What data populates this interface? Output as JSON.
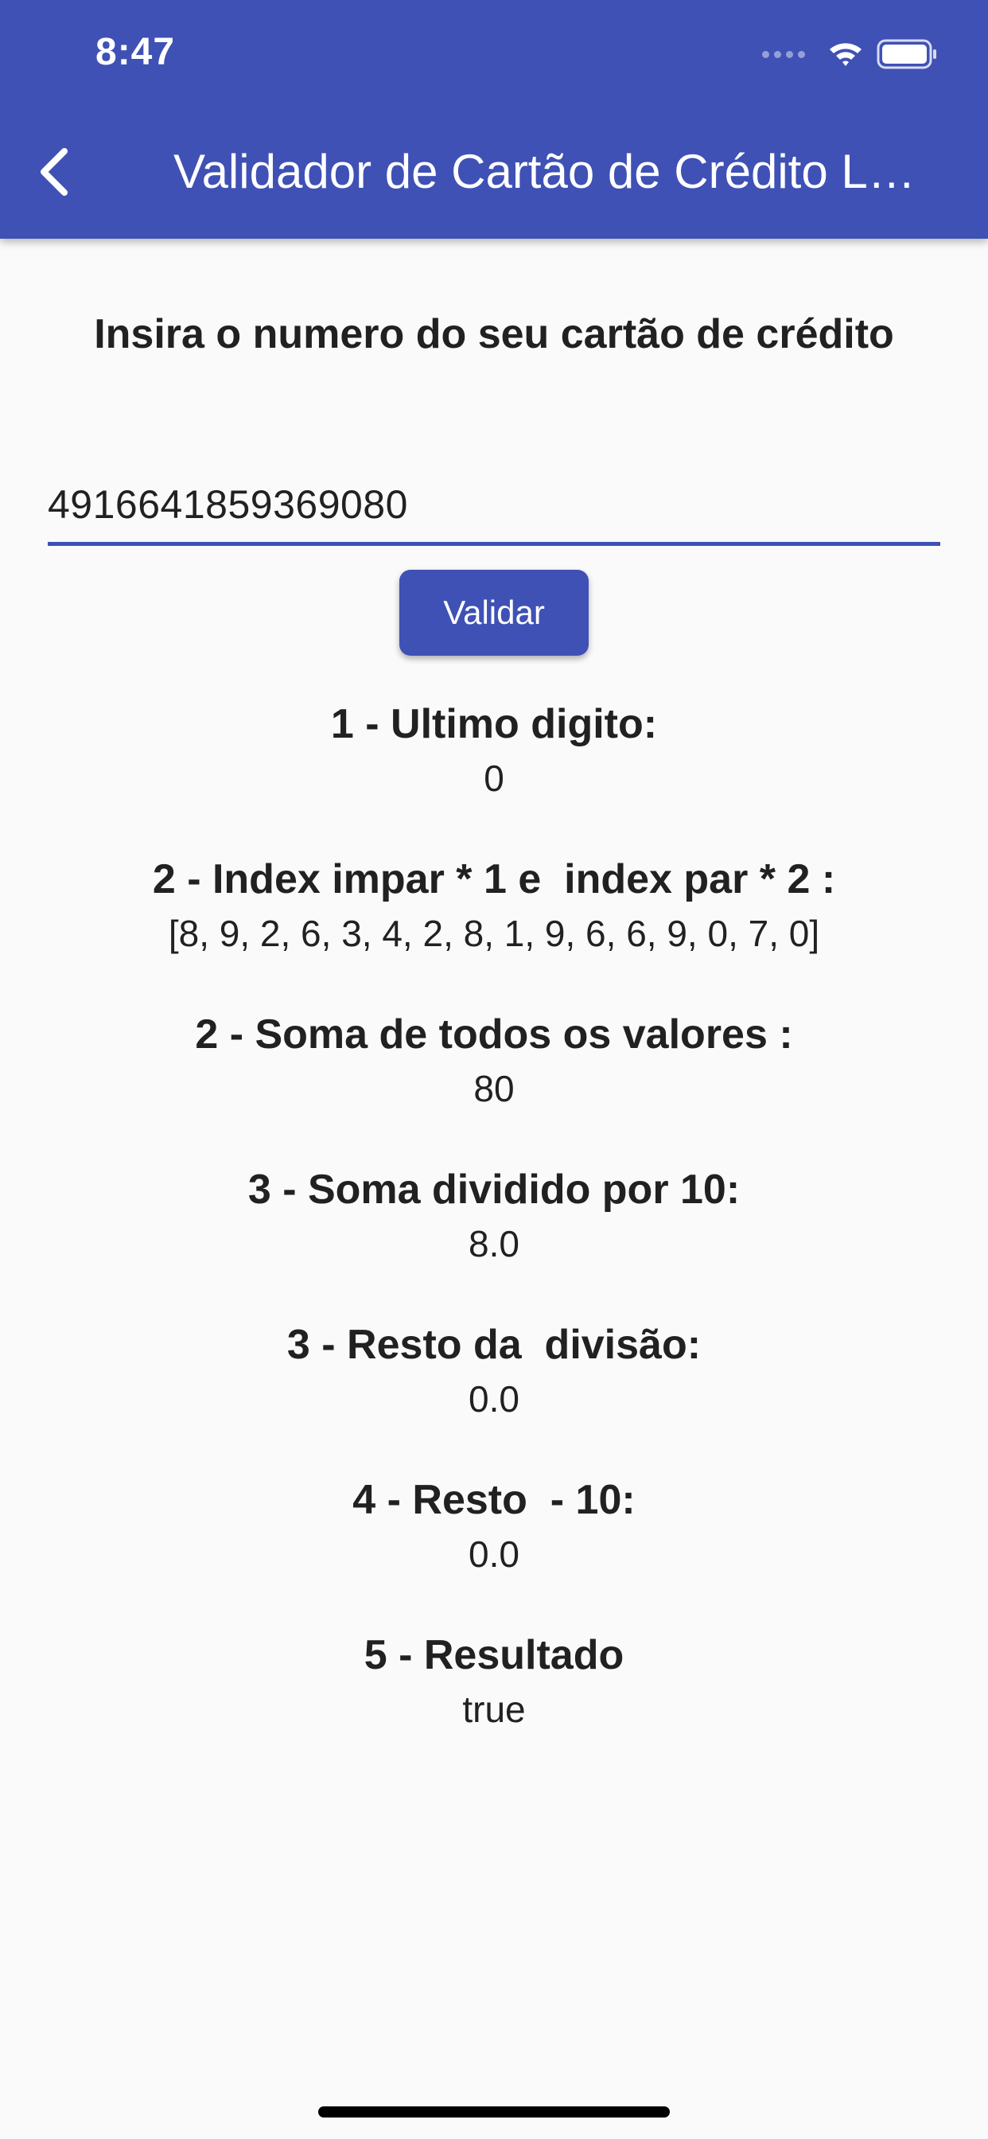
{
  "colors": {
    "primary": "#3f51b5",
    "background": "#fafafa",
    "text": "#212121",
    "on_primary": "#ffffff"
  },
  "status_bar": {
    "time": "8:47",
    "icons": [
      "signal-icon",
      "wifi-icon",
      "battery-icon"
    ]
  },
  "app_bar": {
    "back_icon": "chevron-left-icon",
    "title": "Validador de Cartão de Crédito Luhn"
  },
  "form": {
    "prompt": "Insira o numero do seu cartão de crédito",
    "card_number": "4916641859369080",
    "validate_label": "Validar"
  },
  "results": [
    {
      "label": "1 - Ultimo digito:",
      "value": "0"
    },
    {
      "label": "2 - Index impar * 1 e  index par * 2 :",
      "value": "[8, 9, 2, 6, 3, 4, 2, 8, 1, 9, 6, 6, 9, 0, 7, 0]"
    },
    {
      "label": "2 - Soma de todos os valores :",
      "value": "80"
    },
    {
      "label": "3 - Soma dividido por 10:",
      "value": "8.0"
    },
    {
      "label": "3 - Resto da  divisão:",
      "value": "0.0"
    },
    {
      "label": "4 - Resto  - 10:",
      "value": "0.0"
    },
    {
      "label": "5 - Resultado",
      "value": "true"
    }
  ]
}
